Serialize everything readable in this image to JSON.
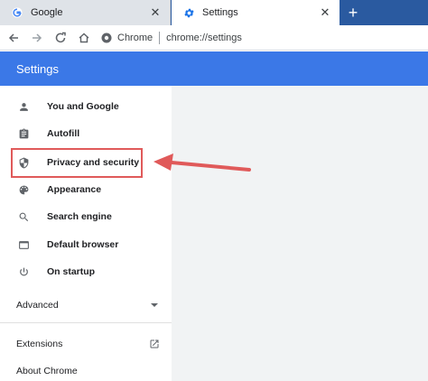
{
  "tabs": [
    {
      "title": "Google",
      "favicon": "google-icon"
    },
    {
      "title": "Settings",
      "favicon": "gear-icon"
    }
  ],
  "toolbar": {
    "site_chip": "Chrome",
    "url": "chrome://settings"
  },
  "header": {
    "title": "Settings"
  },
  "sidebar": {
    "items": [
      {
        "label": "You and Google",
        "icon": "person-icon"
      },
      {
        "label": "Autofill",
        "icon": "clipboard-icon"
      },
      {
        "label": "Privacy and security",
        "icon": "shield-icon"
      },
      {
        "label": "Appearance",
        "icon": "palette-icon"
      },
      {
        "label": "Search engine",
        "icon": "search-icon"
      },
      {
        "label": "Default browser",
        "icon": "browser-window-icon"
      },
      {
        "label": "On startup",
        "icon": "power-icon"
      }
    ],
    "advanced_label": "Advanced",
    "extensions_label": "Extensions",
    "about_label": "About Chrome"
  },
  "colors": {
    "tabstrip": "#2a5aa0",
    "header": "#3b78e7",
    "highlight": "#e05a5a"
  }
}
